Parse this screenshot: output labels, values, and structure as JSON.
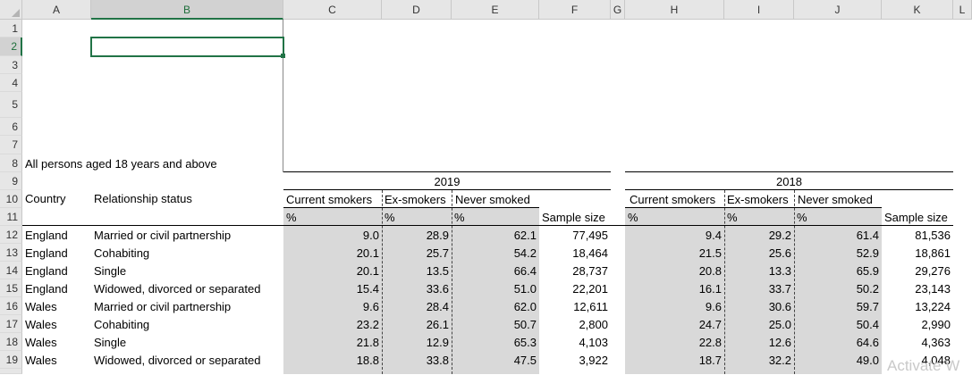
{
  "columns": [
    "A",
    "B",
    "C",
    "D",
    "E",
    "F",
    "G",
    "H",
    "I",
    "J",
    "K",
    "L"
  ],
  "rows": [
    "1",
    "2",
    "3",
    "4",
    "5",
    "6",
    "7",
    "8",
    "9",
    "10",
    "11",
    "12",
    "13",
    "14",
    "15",
    "16",
    "17",
    "18",
    "19"
  ],
  "title_note": "All persons aged 18 years and above",
  "year_a": "2019",
  "year_b": "2018",
  "headers": {
    "country": "Country",
    "relationship": "Relationship status",
    "current": "Current smokers",
    "ex": "Ex-smokers",
    "never": "Never smoked",
    "pct": "%",
    "sample": "Sample size"
  },
  "data": [
    {
      "country": "England",
      "status": "Married or civil partnership",
      "c19": "9.0",
      "e19": "28.9",
      "n19": "62.1",
      "s19": "77,495",
      "c18": "9.4",
      "e18": "29.2",
      "n18": "61.4",
      "s18": "81,536"
    },
    {
      "country": "England",
      "status": "Cohabiting",
      "c19": "20.1",
      "e19": "25.7",
      "n19": "54.2",
      "s19": "18,464",
      "c18": "21.5",
      "e18": "25.6",
      "n18": "52.9",
      "s18": "18,861"
    },
    {
      "country": "England",
      "status": "Single",
      "c19": "20.1",
      "e19": "13.5",
      "n19": "66.4",
      "s19": "28,737",
      "c18": "20.8",
      "e18": "13.3",
      "n18": "65.9",
      "s18": "29,276"
    },
    {
      "country": "England",
      "status": "Widowed, divorced or separated",
      "c19": "15.4",
      "e19": "33.6",
      "n19": "51.0",
      "s19": "22,201",
      "c18": "16.1",
      "e18": "33.7",
      "n18": "50.2",
      "s18": "23,143"
    },
    {
      "country": "Wales",
      "status": "Married or civil partnership",
      "c19": "9.6",
      "e19": "28.4",
      "n19": "62.0",
      "s19": "12,611",
      "c18": "9.6",
      "e18": "30.6",
      "n18": "59.7",
      "s18": "13,224"
    },
    {
      "country": "Wales",
      "status": "Cohabiting",
      "c19": "23.2",
      "e19": "26.1",
      "n19": "50.7",
      "s19": "2,800",
      "c18": "24.7",
      "e18": "25.0",
      "n18": "50.4",
      "s18": "2,990"
    },
    {
      "country": "Wales",
      "status": "Single",
      "c19": "21.8",
      "e19": "12.9",
      "n19": "65.3",
      "s19": "4,103",
      "c18": "22.8",
      "e18": "12.6",
      "n18": "64.6",
      "s18": "4,363"
    },
    {
      "country": "Wales",
      "status": "Widowed, divorced or separated",
      "c19": "18.8",
      "e19": "33.8",
      "n19": "47.5",
      "s19": "3,922",
      "c18": "18.7",
      "e18": "32.2",
      "n18": "49.0",
      "s18": "4,048"
    }
  ],
  "watermark": "Activate W",
  "colors": {
    "selection": "#217346",
    "shade": "#d9d9d9",
    "header_bg": "#e6e6e6"
  }
}
